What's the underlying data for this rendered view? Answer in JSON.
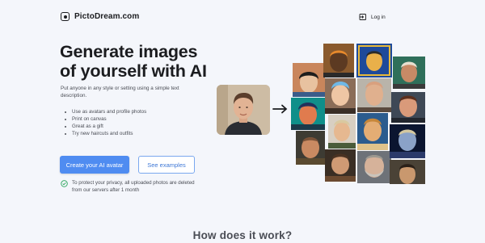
{
  "header": {
    "brand": "PictoDream.com",
    "login_label": "Log in"
  },
  "hero": {
    "title_line1": "Generate images",
    "title_line2": "of yourself with AI",
    "description": "Put anyone in any style or setting using a simple text description.",
    "features": [
      "Use as avatars and profile photos",
      "Print on canvas",
      "Great as a gift",
      "Try new haircuts and outfits"
    ],
    "primary_button": "Create your AI avatar",
    "secondary_button": "See examples",
    "privacy_note": "To protect your privacy, all uploaded photos are deleted from our servers after 1 month"
  },
  "section": {
    "how_title": "How does it work?"
  },
  "colors": {
    "accent": "#4f8cf1",
    "background": "#f4f6fb",
    "privacy_check": "#27a45a"
  }
}
